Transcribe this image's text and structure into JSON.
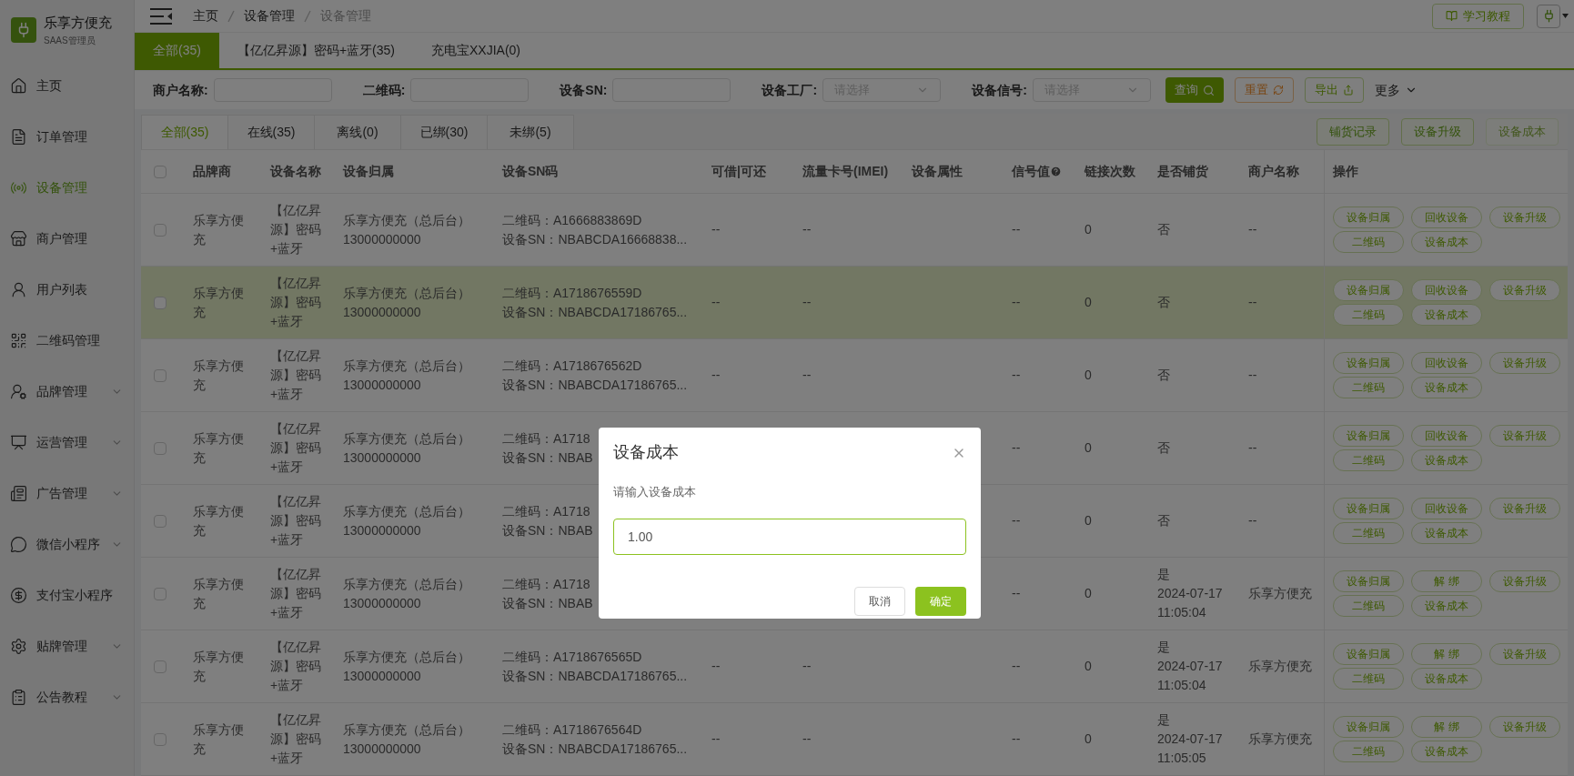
{
  "sidebar": {
    "brand": "乐享方便充",
    "role": "SAAS管理员",
    "items": [
      {
        "label": "主页",
        "selected": false,
        "expandable": false
      },
      {
        "label": "订单管理",
        "selected": false,
        "expandable": false
      },
      {
        "label": "设备管理",
        "selected": true,
        "expandable": false
      },
      {
        "label": "商户管理",
        "selected": false,
        "expandable": false
      },
      {
        "label": "用户列表",
        "selected": false,
        "expandable": false
      },
      {
        "label": "二维码管理",
        "selected": false,
        "expandable": false
      },
      {
        "label": "品牌管理",
        "selected": false,
        "expandable": true
      },
      {
        "label": "运营管理",
        "selected": false,
        "expandable": true
      },
      {
        "label": "广告管理",
        "selected": false,
        "expandable": true
      },
      {
        "label": "微信小程序",
        "selected": false,
        "expandable": true
      },
      {
        "label": "支付宝小程序",
        "selected": false,
        "expandable": false
      },
      {
        "label": "贴牌管理",
        "selected": false,
        "expandable": true
      },
      {
        "label": "公告教程",
        "selected": false,
        "expandable": true
      }
    ]
  },
  "breadcrumb": [
    "主页",
    "设备管理",
    "设备管理"
  ],
  "tutorial_button": "学习教程",
  "category_tabs": [
    {
      "label": "全部(35)",
      "selected": true
    },
    {
      "label": "【亿亿昇源】密码+蓝牙(35)",
      "selected": false
    },
    {
      "label": "充电宝XXJIA(0)",
      "selected": false
    }
  ],
  "filters": [
    {
      "kind": "input",
      "label": "商户名称:"
    },
    {
      "kind": "input",
      "label": "二维码:"
    },
    {
      "kind": "input",
      "label": "设备SN:"
    },
    {
      "kind": "select",
      "label": "设备工厂:",
      "placeholder": "请选择"
    },
    {
      "kind": "select",
      "label": "设备信号:",
      "placeholder": "请选择"
    }
  ],
  "filter_actions": [
    {
      "kind": "search",
      "label": "查询"
    },
    {
      "kind": "reset",
      "label": "重置"
    },
    {
      "kind": "export",
      "label": "导出"
    },
    {
      "kind": "more",
      "label": "更多"
    }
  ],
  "status_tabs": [
    {
      "label": "全部(35)",
      "selected": true
    },
    {
      "label": "在线(35)",
      "selected": false
    },
    {
      "label": "离线(0)",
      "selected": false
    },
    {
      "label": "已绑(30)",
      "selected": false
    },
    {
      "label": "未绑(5)",
      "selected": false
    }
  ],
  "table_actions": [
    {
      "label": "铺货记录",
      "disabled": false
    },
    {
      "label": "设备升级",
      "disabled": false
    },
    {
      "label": "设备成本",
      "disabled": true
    }
  ],
  "table": {
    "all_checked": false,
    "columns": [
      {
        "label": "品牌商",
        "help": false
      },
      {
        "label": "设备名称",
        "help": false
      },
      {
        "label": "设备归属",
        "help": false
      },
      {
        "label": "设备SN码",
        "help": false
      },
      {
        "label": "可借|可还",
        "help": false
      },
      {
        "label": "流量卡号(IMEI)",
        "help": false
      },
      {
        "label": "设备属性",
        "help": false
      },
      {
        "label": "信号值",
        "help": true
      },
      {
        "label": "链接次数",
        "help": false
      },
      {
        "label": "是否铺货",
        "help": false
      },
      {
        "label": "商户名称",
        "help": false
      },
      {
        "label": "操作",
        "help": false
      }
    ],
    "rows": [
      {
        "selected": false,
        "checked": false,
        "brand": "乐享方便充",
        "name": "【亿亿昇源】密码+蓝牙",
        "owner": "乐享方便充（总后台）",
        "phone": "13000000000",
        "qr": "二维码：A1666883869D",
        "sn": "设备SN：NBABCDA16668838...",
        "borrow": "--",
        "imei": "--",
        "signal": "--",
        "links": "0",
        "stocked": "否",
        "merchant": "--",
        "actions": [
          "设备归属",
          "回收设备",
          "设备升级",
          "二维码",
          "设备成本"
        ]
      },
      {
        "selected": true,
        "checked": false,
        "brand": "乐享方便充",
        "name": "【亿亿昇源】密码+蓝牙",
        "owner": "乐享方便充（总后台）",
        "phone": "13000000000",
        "qr": "二维码：A1718676559D",
        "sn": "设备SN：NBABCDA17186765...",
        "borrow": "--",
        "imei": "--",
        "signal": "--",
        "links": "0",
        "stocked": "否",
        "merchant": "--",
        "actions": [
          "设备归属",
          "回收设备",
          "设备升级",
          "二维码",
          "设备成本"
        ]
      },
      {
        "selected": false,
        "checked": false,
        "brand": "乐享方便充",
        "name": "【亿亿昇源】密码+蓝牙",
        "owner": "乐享方便充（总后台）",
        "phone": "13000000000",
        "qr": "二维码：A1718676562D",
        "sn": "设备SN：NBABCDA17186765...",
        "borrow": "--",
        "imei": "--",
        "signal": "--",
        "links": "0",
        "stocked": "否",
        "merchant": "--",
        "actions": [
          "设备归属",
          "回收设备",
          "设备升级",
          "二维码",
          "设备成本"
        ]
      },
      {
        "selected": false,
        "checked": false,
        "brand": "乐享方便充",
        "name": "【亿亿昇源】密码+蓝牙",
        "owner": "乐享方便充（总后台）",
        "phone": "13000000000",
        "qr": "二维码：A1718",
        "sn": "设备SN：NBAB",
        "signal": "--",
        "links": "0",
        "stocked": "否",
        "merchant": "--",
        "actions": [
          "设备归属",
          "回收设备",
          "设备升级",
          "二维码",
          "设备成本"
        ]
      },
      {
        "selected": false,
        "checked": false,
        "brand": "乐享方便充",
        "name": "【亿亿昇源】密码+蓝牙",
        "owner": "乐享方便充（总后台）",
        "phone": "13000000000",
        "qr": "二维码：A1718",
        "sn": "设备SN：NBAB",
        "signal": "--",
        "links": "0",
        "stocked": "否",
        "merchant": "--",
        "actions": [
          "设备归属",
          "回收设备",
          "设备升级",
          "二维码",
          "设备成本"
        ]
      },
      {
        "selected": false,
        "checked": false,
        "brand": "乐享方便充",
        "name": "【亿亿昇源】密码+蓝牙",
        "owner": "乐享方便充（总后台）",
        "phone": "13000000000",
        "qr": "二维码：A1718",
        "sn": "设备SN：NBAB",
        "signal": "--",
        "links": "0",
        "stocked": "是",
        "stocked_date": "2024-07-17",
        "stocked_time": "11:05:04",
        "merchant": "乐享方便充",
        "actions": [
          "设备归属",
          "解 绑",
          "设备升级",
          "二维码",
          "设备成本"
        ]
      },
      {
        "selected": false,
        "checked": false,
        "brand": "乐享方便充",
        "name": "【亿亿昇源】密码+蓝牙",
        "owner": "乐享方便充（总后台）",
        "phone": "13000000000",
        "qr": "二维码：A1718676565D",
        "sn": "设备SN：NBABCDA17186765...",
        "borrow": "--",
        "imei": "--",
        "signal": "--",
        "links": "0",
        "stocked": "是",
        "stocked_date": "2024-07-17",
        "stocked_time": "11:05:04",
        "merchant": "乐享方便充",
        "actions": [
          "设备归属",
          "解 绑",
          "设备升级",
          "二维码",
          "设备成本"
        ]
      },
      {
        "selected": false,
        "checked": false,
        "brand": "乐享方便充",
        "name": "【亿亿昇源】密码+蓝牙",
        "owner": "乐享方便充（总后台）",
        "phone": "13000000000",
        "qr": "二维码：A1718676564D",
        "sn": "设备SN：NBABCDA17186765...",
        "borrow": "--",
        "imei": "--",
        "signal": "--",
        "links": "0",
        "stocked": "是",
        "stocked_date": "2024-07-17",
        "stocked_time": "11:05:05",
        "merchant": "乐享方便充",
        "actions": [
          "设备归属",
          "解 绑",
          "设备升级",
          "二维码",
          "设备成本"
        ]
      }
    ]
  },
  "dialog": {
    "title": "设备成本",
    "label": "请输入设备成本",
    "value": "1.00",
    "buttons": [
      {
        "kind": "cancel",
        "label": "取消"
      },
      {
        "kind": "confirm",
        "label": "确定"
      }
    ]
  }
}
